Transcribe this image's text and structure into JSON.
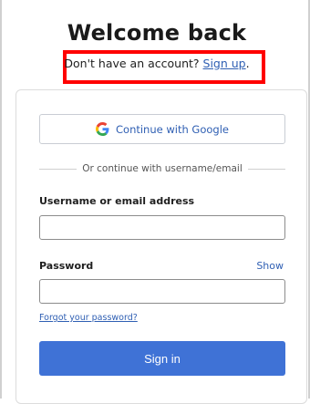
{
  "header": {
    "title": "Welcome back",
    "prompt_text": "Don't have an account? ",
    "signup_link": "Sign up",
    "signup_punct": "."
  },
  "google": {
    "label": "Continue with Google",
    "icon": "google-icon"
  },
  "divider": {
    "text": "Or continue with username/email"
  },
  "form": {
    "username_label": "Username or email address",
    "username_value": "",
    "password_label": "Password",
    "password_value": "",
    "show_label": "Show",
    "forgot_label": "Forgot your password?",
    "submit_label": "Sign in"
  },
  "colors": {
    "accent": "#3f72d6",
    "link": "#2f5fb3",
    "highlight_box": "#ff0000"
  }
}
